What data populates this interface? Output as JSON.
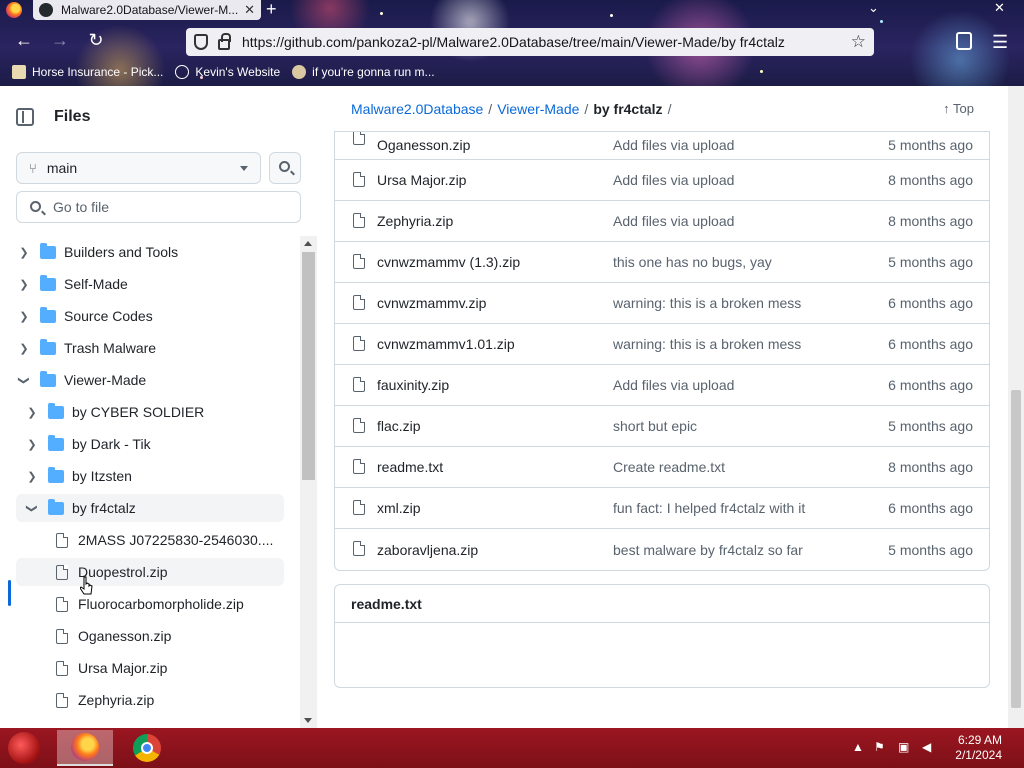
{
  "browser": {
    "tab_title": "Malware2.0Database/Viewer-M...",
    "url": "https://github.com/pankoza2-pl/Malware2.0Database/tree/main/Viewer-Made/by fr4ctalz",
    "bookmarks": [
      "Horse Insurance - Pick...",
      "Kevin's Website",
      "if you're gonna run m..."
    ]
  },
  "sidebar": {
    "title": "Files",
    "branch": "main",
    "search_placeholder": "Go to file",
    "tree": [
      {
        "label": "Builders and Tools",
        "type": "folder",
        "expanded": false
      },
      {
        "label": "Self-Made",
        "type": "folder",
        "expanded": false
      },
      {
        "label": "Source Codes",
        "type": "folder",
        "expanded": false
      },
      {
        "label": "Trash Malware",
        "type": "folder",
        "expanded": false
      },
      {
        "label": "Viewer-Made",
        "type": "folder",
        "expanded": true
      },
      {
        "label": "by CYBER SOLDIER",
        "type": "folder",
        "expanded": false
      },
      {
        "label": "by Dark - Tik",
        "type": "folder",
        "expanded": false
      },
      {
        "label": "by Itzsten",
        "type": "folder",
        "expanded": false
      },
      {
        "label": "by fr4ctalz",
        "type": "folder",
        "expanded": true,
        "selected": true
      },
      {
        "label": "2MASS J07225830-2546030....",
        "type": "file"
      },
      {
        "label": "Duopestrol.zip",
        "type": "file",
        "hovered": true
      },
      {
        "label": "Fluorocarbomorpholide.zip",
        "type": "file"
      },
      {
        "label": "Oganesson.zip",
        "type": "file"
      },
      {
        "label": "Ursa Major.zip",
        "type": "file"
      },
      {
        "label": "Zephyria.zip",
        "type": "file"
      }
    ]
  },
  "breadcrumb": {
    "repo": "Malware2.0Database",
    "folder": "Viewer-Made",
    "current": "by fr4ctalz",
    "sep": "/",
    "top_label": "Top"
  },
  "files": [
    {
      "name": "Oganesson.zip",
      "message": "Add files via upload",
      "age": "5 months ago"
    },
    {
      "name": "Ursa Major.zip",
      "message": "Add files via upload",
      "age": "8 months ago"
    },
    {
      "name": "Zephyria.zip",
      "message": "Add files via upload",
      "age": "8 months ago"
    },
    {
      "name": "cvnwzmammv (1.3).zip",
      "message": "this one has no bugs, yay",
      "age": "5 months ago"
    },
    {
      "name": "cvnwzmammv.zip",
      "message": "warning: this is a broken mess",
      "age": "6 months ago"
    },
    {
      "name": "cvnwzmammv1.01.zip",
      "message": "warning: this is a broken mess",
      "age": "6 months ago"
    },
    {
      "name": "fauxinity.zip",
      "message": "Add files via upload",
      "age": "6 months ago"
    },
    {
      "name": "flac.zip",
      "message": "short but epic",
      "age": "5 months ago"
    },
    {
      "name": "readme.txt",
      "message": "Create readme.txt",
      "age": "8 months ago"
    },
    {
      "name": "xml.zip",
      "message": "fun fact: I helped fr4ctalz with it",
      "age": "6 months ago"
    },
    {
      "name": "zaboravljena.zip",
      "message": "best malware by fr4ctalz so far",
      "age": "5 months ago"
    }
  ],
  "readme": {
    "title": "readme.txt"
  },
  "taskbar": {
    "time": "6:29 AM",
    "date": "2/1/2024"
  },
  "colors": {
    "link": "#0969da",
    "folder": "#54aeff",
    "border": "#d1d9e0",
    "muted": "#59636e",
    "taskbar": "#9b1620"
  },
  "icons": {
    "back": "arrow-left-icon",
    "forward": "arrow-right-icon",
    "reload": "reload-icon",
    "file": "file-icon",
    "folder": "folder-icon"
  }
}
